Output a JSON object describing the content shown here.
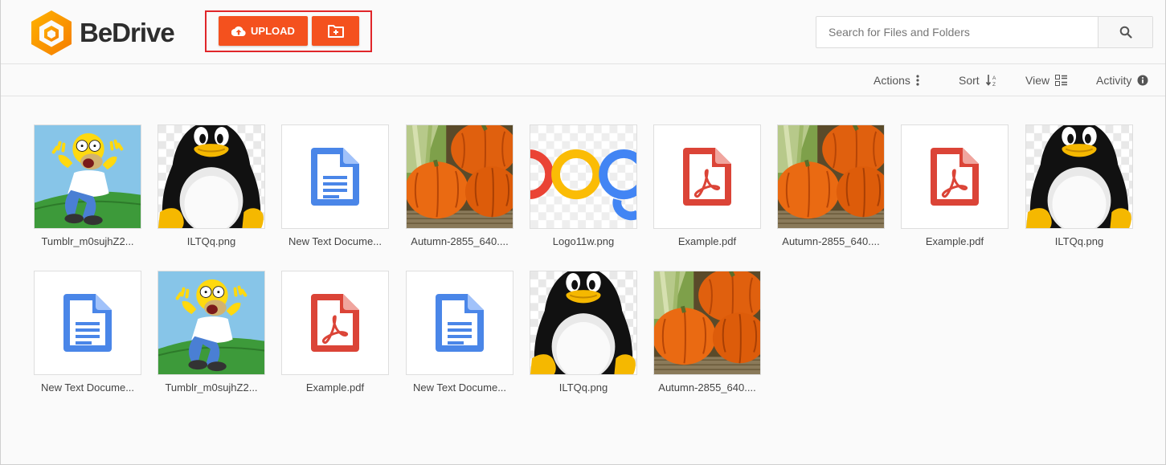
{
  "app": {
    "name": "BeDrive"
  },
  "header": {
    "upload_label": "UPLOAD",
    "search_placeholder": "Search for Files and Folders"
  },
  "toolbar": {
    "actions_label": "Actions",
    "sort_label": "Sort",
    "view_label": "View",
    "activity_label": "Activity"
  },
  "files": [
    {
      "name": "Tumblr_m0sujhZ2...",
      "kind": "homer"
    },
    {
      "name": "ILTQq.png",
      "kind": "penguin"
    },
    {
      "name": "New Text Docume...",
      "kind": "doc"
    },
    {
      "name": "Autumn-2855_640....",
      "kind": "pumpkin"
    },
    {
      "name": "Logo11w.png",
      "kind": "google"
    },
    {
      "name": "Example.pdf",
      "kind": "pdf"
    },
    {
      "name": "Autumn-2855_640....",
      "kind": "pumpkin"
    },
    {
      "name": "Example.pdf",
      "kind": "pdf"
    },
    {
      "name": "ILTQq.png",
      "kind": "penguin"
    },
    {
      "name": "New Text Docume...",
      "kind": "doc"
    },
    {
      "name": "Tumblr_m0sujhZ2...",
      "kind": "homer"
    },
    {
      "name": "Example.pdf",
      "kind": "pdf"
    },
    {
      "name": "New Text Docume...",
      "kind": "doc"
    },
    {
      "name": "ILTQq.png",
      "kind": "penguin"
    },
    {
      "name": "Autumn-2855_640....",
      "kind": "pumpkin"
    }
  ],
  "colors": {
    "accent": "#f4511e",
    "doc_blue": "#4a86e8",
    "pdf_red": "#db4437",
    "highlight": "#e0262a"
  }
}
